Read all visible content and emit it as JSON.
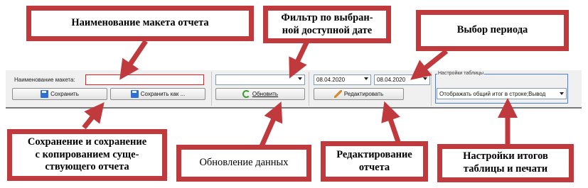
{
  "callouts": {
    "report_name": "Наименование макета отчета",
    "date_filter": "Фильтр по выбран-\nной доступной дате",
    "period": "Выбор периода",
    "save": "Сохранение и сохранение\nс копированием суще-\nствующего отчета",
    "refresh": "Обновление данных",
    "edit": "Редактирование\nотчета",
    "settings": "Настройки итогов\nтаблицы и печати"
  },
  "toolbar": {
    "layout_name_label": "Наименование макета:",
    "layout_name_value": "",
    "save_label": "Сохранить",
    "save_as_label": "Сохранить как ...",
    "date_filter_value": "",
    "refresh_label": "Обновить",
    "date_from": "08.04.2020",
    "date_to": "08.04.2020",
    "edit_label": "Редактировать",
    "settings_group_title": "Настройки таблицы",
    "settings_value": "Отображать общий итог в строке;Вывод"
  },
  "colors": {
    "callout_border": "#c0393d",
    "group_border": "#4a7fd6",
    "name_field_border": "#e01f1f"
  }
}
